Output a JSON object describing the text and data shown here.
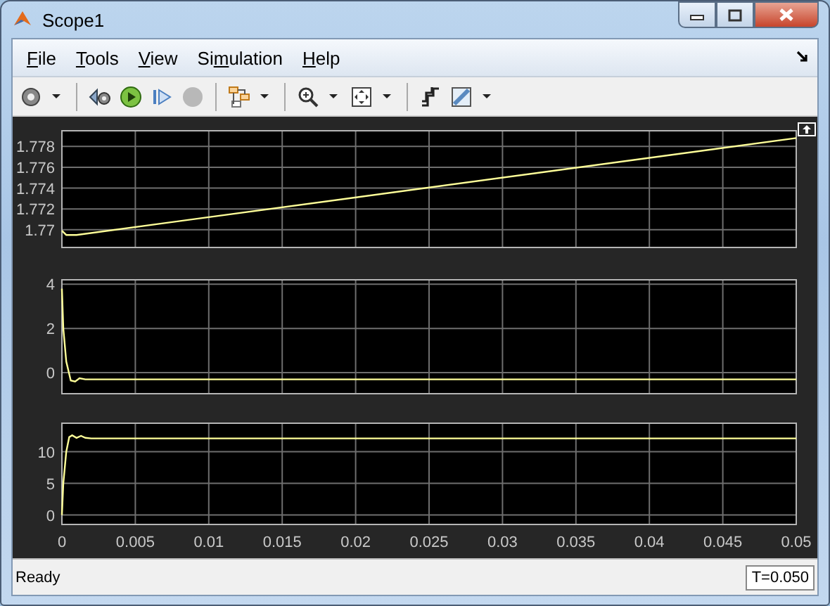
{
  "window": {
    "title": "Scope1"
  },
  "menu": [
    {
      "mnemonic": "F",
      "after": "ile"
    },
    {
      "mnemonic": "T",
      "after": "ools"
    },
    {
      "mnemonic": "V",
      "after": "iew"
    },
    {
      "before": "Si",
      "mnemonic": "m",
      "after": "ulation"
    },
    {
      "mnemonic": "H",
      "after": "elp"
    }
  ],
  "toolbar": [
    {
      "kind": "button",
      "disabled": false,
      "dropdown": true
    },
    {
      "kind": "separator"
    },
    {
      "kind": "button",
      "disabled": false,
      "dropdown": false
    },
    {
      "kind": "button",
      "disabled": false,
      "dropdown": false
    },
    {
      "kind": "button",
      "disabled": false,
      "dropdown": false
    },
    {
      "kind": "button",
      "disabled": true,
      "dropdown": false
    },
    {
      "kind": "separator"
    },
    {
      "kind": "button",
      "disabled": false,
      "dropdown": true
    },
    {
      "kind": "separator"
    },
    {
      "kind": "button",
      "disabled": false,
      "dropdown": true
    },
    {
      "kind": "button",
      "disabled": false,
      "dropdown": true
    },
    {
      "kind": "separator"
    },
    {
      "kind": "button",
      "disabled": false,
      "dropdown": false
    },
    {
      "kind": "button",
      "disabled": false,
      "dropdown": true
    }
  ],
  "plots": [
    {
      "chart_data": {
        "type": "line",
        "grid": true,
        "xlim": [
          0,
          0.05
        ],
        "ylim": [
          1.7683,
          1.7795
        ],
        "yticks": [
          {
            "value": 1.77,
            "label": "1.77"
          },
          {
            "value": 1.772,
            "label": "1.772"
          },
          {
            "value": 1.774,
            "label": "1.774"
          },
          {
            "value": 1.776,
            "label": "1.776"
          },
          {
            "value": 1.778,
            "label": "1.778"
          }
        ],
        "x": [
          0,
          0.0003,
          0.001,
          0.05
        ],
        "series": [
          {
            "color": "#ffff99",
            "values": [
              1.7699,
              1.7695,
              1.7695,
              1.7788
            ]
          }
        ]
      }
    },
    {
      "chart_data": {
        "type": "line",
        "grid": true,
        "xlim": [
          0,
          0.05
        ],
        "ylim": [
          -0.95,
          4.2
        ],
        "yticks": [
          {
            "value": 0,
            "label": "0"
          },
          {
            "value": 2,
            "label": "2"
          },
          {
            "value": 4,
            "label": "4"
          }
        ],
        "x": [
          0,
          0.0001,
          0.0003,
          0.0006,
          0.0009,
          0.0012,
          0.0016,
          0.002,
          0.05
        ],
        "series": [
          {
            "color": "#ffff99",
            "values": [
              3.8,
              2,
              0.5,
              -0.35,
              -0.4,
              -0.25,
              -0.3,
              -0.3,
              -0.3
            ]
          }
        ]
      }
    },
    {
      "chart_data": {
        "type": "line",
        "grid": true,
        "xlim": [
          0,
          0.05
        ],
        "ylim": [
          -1.5,
          14.5
        ],
        "xticks": [
          {
            "value": 0,
            "label": "0"
          },
          {
            "value": 0.005,
            "label": "0.005"
          },
          {
            "value": 0.01,
            "label": "0.01"
          },
          {
            "value": 0.015,
            "label": "0.015"
          },
          {
            "value": 0.02,
            "label": "0.02"
          },
          {
            "value": 0.025,
            "label": "0.025"
          },
          {
            "value": 0.03,
            "label": "0.03"
          },
          {
            "value": 0.035,
            "label": "0.035"
          },
          {
            "value": 0.04,
            "label": "0.04"
          },
          {
            "value": 0.045,
            "label": "0.045"
          },
          {
            "value": 0.05,
            "label": "0.05"
          }
        ],
        "yticks": [
          {
            "value": 0,
            "label": "0"
          },
          {
            "value": 5,
            "label": "5"
          },
          {
            "value": 10,
            "label": "10"
          }
        ],
        "x": [
          0,
          0.0001,
          0.0003,
          0.0005,
          0.0007,
          0.001,
          0.0013,
          0.0016,
          0.002,
          0.05
        ],
        "series": [
          {
            "color": "#ffff99",
            "values": [
              0,
              5,
              10,
              12.3,
              12.6,
              12.2,
              12.5,
              12.2,
              12.1,
              12.1
            ]
          }
        ]
      }
    }
  ],
  "status_bar": {
    "message": "Ready",
    "time": "T=0.050"
  }
}
